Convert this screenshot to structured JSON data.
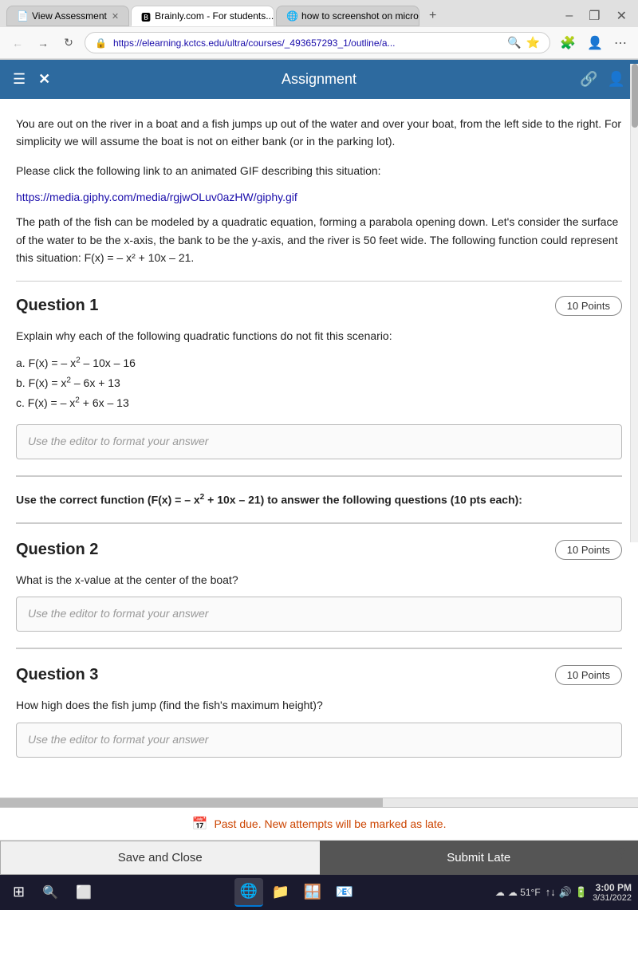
{
  "browser": {
    "tabs": [
      {
        "label": "View Assessment",
        "active": false,
        "icon": "📄"
      },
      {
        "label": "Brainly.com - For students...",
        "active": true,
        "icon": "🅱"
      },
      {
        "label": "how to screenshot on micro",
        "active": false,
        "icon": "🌐"
      }
    ],
    "url": "https://elearning.kctcs.edu/ultra/courses/_493657293_1/outline/a...",
    "nav": {
      "back": "←",
      "forward": "→",
      "refresh": "↻"
    }
  },
  "header": {
    "hamburger": "☰",
    "close": "✕",
    "title": "Assignment",
    "icons": [
      "🔗",
      "👤"
    ]
  },
  "intro": {
    "paragraph1": "You are out on the river in a boat and a fish jumps up out of the water and over your boat, from the left side to the right. For simplicity we will assume the boat is not on either bank (or in the parking lot).",
    "paragraph2": "Please click the following link to an animated GIF describing this situation:",
    "link_text": "https://media.giphy.com/media/rgjwOLuv0azHW/giphy.gif",
    "link_url": "https://media.giphy.com/media/rgjwOLuv0azHW/giphy.gif",
    "paragraph3": "The path of the fish can be modeled by a quadratic equation, forming a parabola opening down. Let's consider the surface of the water to be the x-axis, the bank to be the y-axis, and the river is 50 feet wide. The following function could represent this situation: F(x) = – x² + 10x – 21."
  },
  "section_intro": {
    "bold_text": "Use the correct function (F(x) = – x² + 10x – 21) to answer the following questions (10 pts each):"
  },
  "questions": [
    {
      "id": "question-1",
      "title": "Question 1",
      "points": "10 Points",
      "text": "Explain why each of the following quadratic functions do not fit this scenario:",
      "options": [
        "a. F(x) = – x² – 10x – 16",
        "b. F(x) = x² – 6x + 13",
        "c. F(x) = – x² + 6x – 13"
      ],
      "placeholder": "Use the editor to format your answer"
    },
    {
      "id": "question-2",
      "title": "Question 2",
      "points": "10 Points",
      "text": "What is the x-value at the center of the boat?",
      "options": [],
      "placeholder": "Use the editor to format your answer"
    },
    {
      "id": "question-3",
      "title": "Question 3",
      "points": "10 Points",
      "text": "How high does the fish jump (find the fish's maximum height)?",
      "options": [],
      "placeholder": "Use the editor to format your answer"
    }
  ],
  "bottom_bar": {
    "past_due_text": "Past due. New attempts will be marked as late.",
    "save_close_label": "Save and Close",
    "submit_late_label": "Submit Late"
  },
  "taskbar": {
    "start_icon": "⊞",
    "search_icon": "🔍",
    "task_view": "⬜",
    "apps": [
      {
        "icon": "🌐",
        "label": "Browser",
        "active": true
      },
      {
        "icon": "📁",
        "label": "File Explorer"
      },
      {
        "icon": "🪟",
        "label": "Windows Store"
      },
      {
        "icon": "📧",
        "label": "Mail"
      }
    ],
    "weather": "☁ 51°F",
    "time": "3:00 PM",
    "date": "3/31/2022",
    "system_icons": [
      "↑↓",
      "🔊",
      "🔋",
      "🖥"
    ]
  }
}
